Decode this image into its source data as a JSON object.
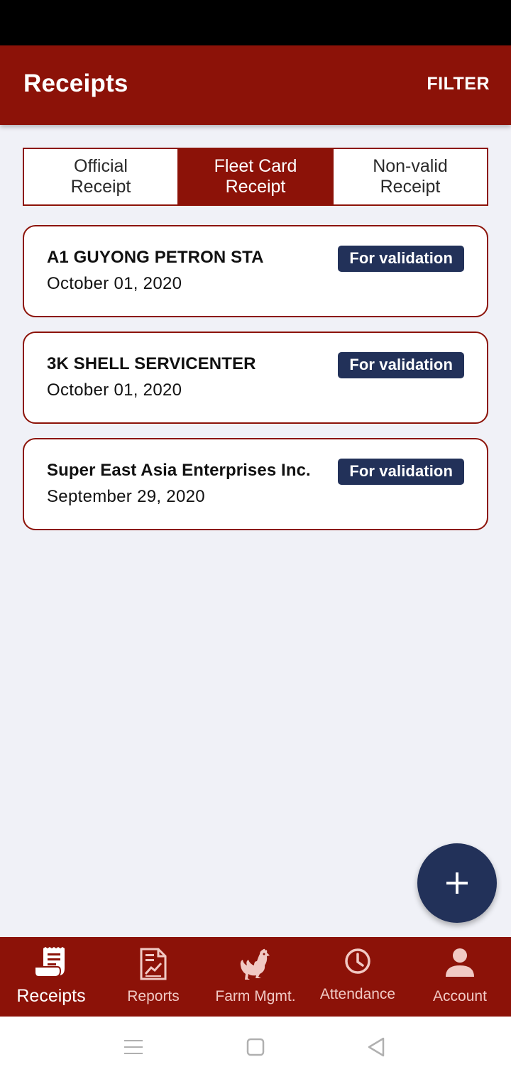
{
  "app_bar": {
    "title": "Receipts",
    "filter_label": "FILTER"
  },
  "tabs": [
    {
      "label_line1": "Official",
      "label_line2": "Receipt",
      "active": false
    },
    {
      "label_line1": "Fleet Card",
      "label_line2": "Receipt",
      "active": true
    },
    {
      "label_line1": "Non-valid",
      "label_line2": "Receipt",
      "active": false
    }
  ],
  "receipts": [
    {
      "name": "A1 GUYONG PETRON STA",
      "date": "October 01, 2020",
      "status": "For validation"
    },
    {
      "name": "3K SHELL SERVICENTER",
      "date": "October 01, 2020",
      "status": "For validation"
    },
    {
      "name": "Super East Asia Enterprises Inc.",
      "date": "September 29, 2020",
      "status": "For validation"
    }
  ],
  "fab": {
    "icon": "plus-icon"
  },
  "bottom_nav": [
    {
      "label": "Receipts",
      "icon": "receipt-icon",
      "active": true
    },
    {
      "label": "Reports",
      "icon": "report-icon",
      "active": false
    },
    {
      "label": "Farm Mgmt.",
      "icon": "chicken-icon",
      "active": false
    },
    {
      "label": "Attendance",
      "icon": "clock-icon",
      "active": false
    },
    {
      "label": "Account",
      "icon": "person-icon",
      "active": false
    }
  ],
  "colors": {
    "primary": "#8c1208",
    "navy": "#223159",
    "background": "#f0f1f7",
    "inactive_nav": "#f1c9c4"
  }
}
